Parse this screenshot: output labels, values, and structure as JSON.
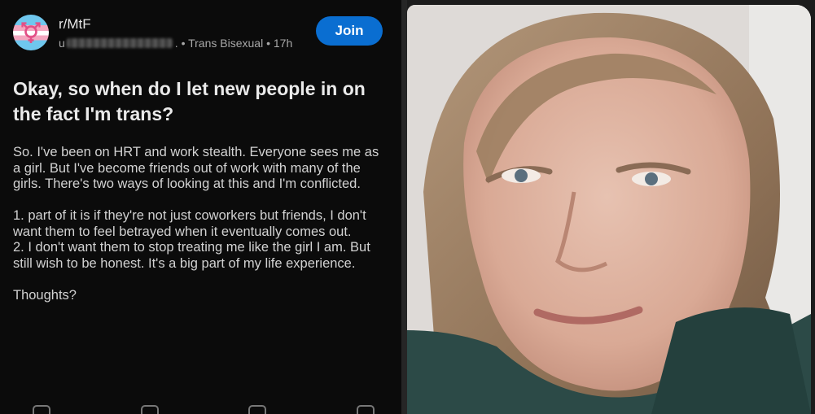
{
  "post": {
    "subreddit": "r/MtF",
    "username_visible": "u",
    "flair_and_time": ". • Trans Bisexual • 17h",
    "join_label": "Join",
    "title": "Okay, so when do I let new people in on the fact I'm trans?",
    "body": [
      "So. I've been on HRT and work stealth. Everyone sees me as a girl. But I've become friends out of work with many of the girls. There's two ways of looking at this and I'm conflicted.",
      "1. part of it is if they're not just coworkers but friends, I don't want them to feel betrayed when it eventually comes out.",
      "2. I don't want them to stop treating me like the girl I am. But still wish to be honest. It's a big part of my life experience.",
      "Thoughts?"
    ]
  },
  "icons": {
    "subreddit_avatar": "trans-symbol-icon",
    "actions": [
      "upvote-icon",
      "comment-icon",
      "share-icon",
      "award-icon"
    ]
  },
  "colors": {
    "join_button": "#0a6ed1",
    "panel_background": "#0b0b0b",
    "trans_blue": "#6fc7ee",
    "trans_pink": "#f3a6bf"
  }
}
